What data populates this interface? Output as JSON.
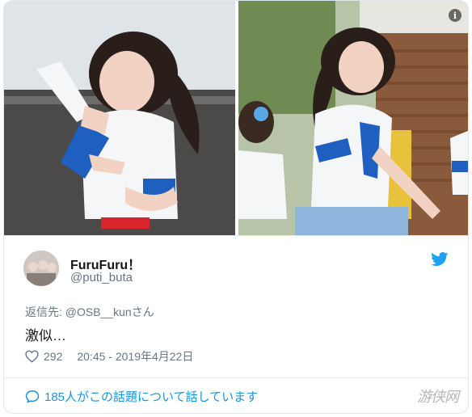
{
  "media": {
    "info_icon_glyph": "i",
    "colors": {
      "sky": "#c9d4dc",
      "uniform_white": "#f4f6f8",
      "uniform_blue": "#1f5fbf",
      "skirt_red": "#d8242c"
    }
  },
  "tweet": {
    "display_name": "FuruFuru！",
    "handle": "@puti_buta",
    "reply_prefix": "返信先: ",
    "reply_mention": "@OSB__kunさん",
    "text": "激似…",
    "likes": "292",
    "timestamp": "20:45 - 2019年4月22日",
    "brand_color": "#1da1f2"
  },
  "footer": {
    "conversation_text": "185人がこの話題について話しています",
    "watermark": "游侠网"
  }
}
